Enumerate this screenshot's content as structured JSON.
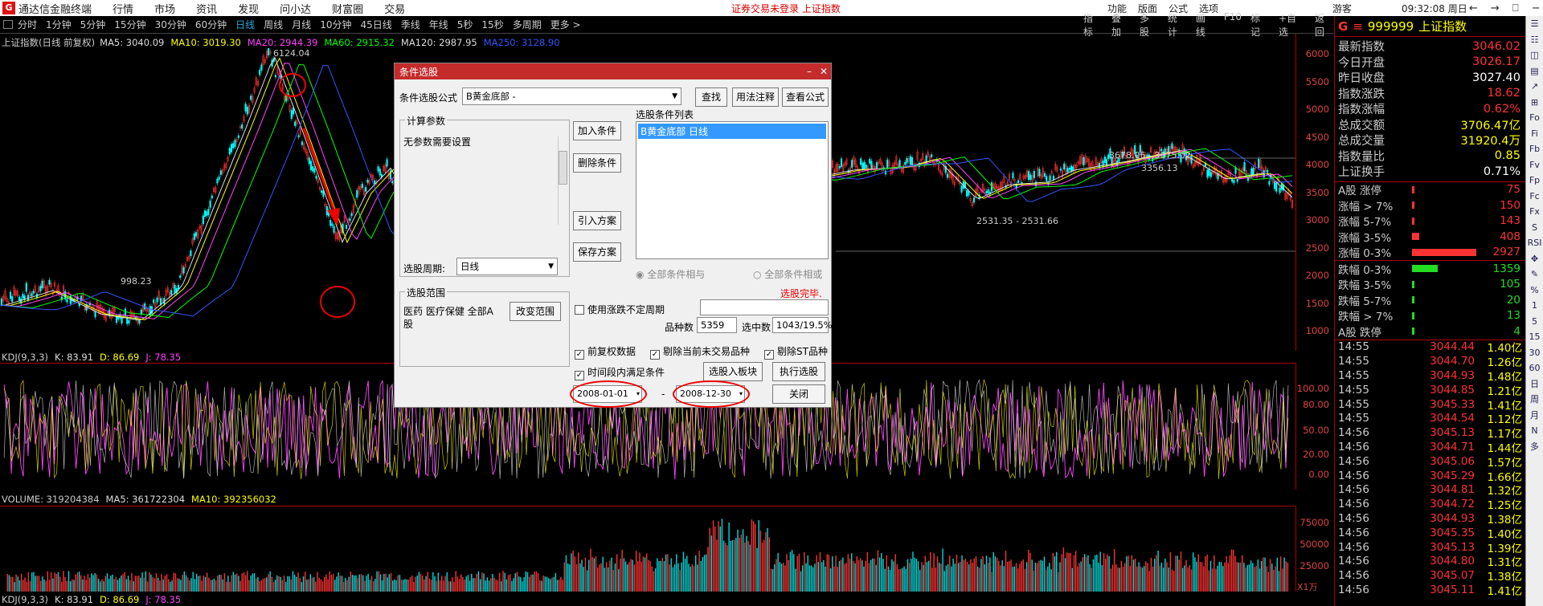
{
  "topbar": {
    "logo_text": "G",
    "app_title": "通达信金融终端",
    "menu": [
      "行情",
      "市场",
      "资讯",
      "发现",
      "问小达",
      "财富圈",
      "交易"
    ],
    "warning": "证券交易未登录  上证指数",
    "right_menu": [
      "功能",
      "版面",
      "公式",
      "选项"
    ],
    "user": "游客",
    "clock": "09:32:08 周日",
    "window_buttons": [
      "←",
      "→",
      "⎕",
      "−",
      "❐",
      "✕"
    ]
  },
  "periods": [
    "分时",
    "1分钟",
    "5分钟",
    "15分钟",
    "30分钟",
    "60分钟",
    "日线",
    "周线",
    "月线",
    "10分钟",
    "45日线",
    "季线",
    "年线",
    "5秒",
    "15秒",
    "多周期",
    "更多 >"
  ],
  "selected_period": "日线",
  "chart_tools": [
    "指标",
    "叠加",
    "多股",
    "统计",
    "画线",
    "F10",
    "标记",
    "+自选",
    "返回"
  ],
  "main_chart": {
    "title": "上证指数(日线 前复权)",
    "ma_legend": [
      {
        "label": "MA5: 3040.09",
        "color": "#dddddd"
      },
      {
        "label": "MA10: 3019.30",
        "color": "#ffff00"
      },
      {
        "label": "MA20: 2944.39",
        "color": "#ff40ff"
      },
      {
        "label": "MA60: 2915.32",
        "color": "#00ff00"
      },
      {
        "label": "MA120: 2987.95",
        "color": "#dddddd"
      },
      {
        "label": "MA250: 3128.90",
        "color": "#3355ff"
      }
    ],
    "y_ticks": [
      "6000",
      "5500",
      "5000",
      "4500",
      "4000",
      "3500",
      "3000",
      "2500",
      "2000",
      "1500",
      "1000"
    ],
    "annotations": [
      "6124.04",
      "998.23",
      "3678.06 - 3675.02",
      "2531.35 - 2531.66",
      "3356.13"
    ]
  },
  "kdj": {
    "legend": [
      {
        "label": "KDJ(9,3,3)",
        "color": "#cccccc"
      },
      {
        "label": "K: 83.91",
        "color": "#dddddd"
      },
      {
        "label": "D: 86.69",
        "color": "#ffff00"
      },
      {
        "label": "J: 78.35",
        "color": "#ff40ff"
      }
    ],
    "y_ticks": [
      "100.00",
      "80.00",
      "50.00",
      "20.00",
      "0.00"
    ]
  },
  "volume": {
    "legend": [
      {
        "label": "VOLUME: 319204384",
        "color": "#cccccc"
      },
      {
        "label": "MA5: 361722304",
        "color": "#dddddd"
      },
      {
        "label": "MA10: 392356032",
        "color": "#ffff00"
      }
    ],
    "y_ticks": [
      "75000",
      "50000",
      "25000"
    ],
    "unit": "X1万"
  },
  "bottom_legend": [
    {
      "label": "KDJ(9,3,3)",
      "color": "#cccccc"
    },
    {
      "label": "K: 83.91",
      "color": "#dddddd"
    },
    {
      "label": "D: 86.69",
      "color": "#ffff00"
    },
    {
      "label": "J: 78.35",
      "color": "#ff40ff"
    }
  ],
  "dialog": {
    "title": "条件选股",
    "formula_label": "条件选股公式",
    "formula_value": "B黄金底部  -",
    "find_btn": "查找",
    "usage_btn": "用法注释",
    "view_btn": "查看公式",
    "params_caption": "计算参数",
    "params_text": "无参数需要设置",
    "add_btn": "加入条件",
    "del_btn": "删除条件",
    "import_btn": "引入方案",
    "save_btn": "保存方案",
    "list_caption": "选股条件列表",
    "list_items": [
      "B黄金底部  日线"
    ],
    "period_label": "选股周期:",
    "period_value": "日线",
    "radio_and": "全部条件相与",
    "radio_or": "全部条件相或",
    "done_text": "选股完毕.",
    "range_caption": "选股范围",
    "range_text": "医药 医疗保健 全部A股",
    "change_range_btn": "改变范围",
    "irregular_label": "使用涨跌不定周期",
    "count_label": "品种数",
    "count_value": "5359",
    "selected_label": "选中数",
    "selected_value": "1043/19.5%",
    "opt_fq": "前复权数据",
    "opt_notrade": "剔除当前未交易品种",
    "opt_st": "剔除ST品种",
    "opt_period": "时间段内满足条件",
    "to_block_btn": "选股入板块",
    "run_btn": "执行选股",
    "date_from": "2008-01-01",
    "date_sep": "-",
    "date_to": "2008-12-30",
    "close_btn": "关闭"
  },
  "quote_panel": {
    "code": "999999",
    "name": "上证指数",
    "stats": [
      {
        "label": "最新指数",
        "value": "3046.02",
        "color": "#ff3333"
      },
      {
        "label": "今日开盘",
        "value": "3026.17",
        "color": "#ff3333"
      },
      {
        "label": "昨日收盘",
        "value": "3027.40",
        "color": "#ffffff"
      },
      {
        "label": "指数涨跌",
        "value": "18.62",
        "color": "#ff3333"
      },
      {
        "label": "指数涨幅",
        "value": "0.62%",
        "color": "#ff3333"
      },
      {
        "label": "总成交额",
        "value": "3706.47亿",
        "color": "#ffff00"
      },
      {
        "label": "总成交量",
        "value": "31920.4万",
        "color": "#ffff00"
      },
      {
        "label": "指数量比",
        "value": "0.85",
        "color": "#ffff00"
      },
      {
        "label": "上证换手",
        "value": "0.71%",
        "color": "#ffffff"
      }
    ],
    "breadth_up": [
      {
        "label": "A股 涨停",
        "value": "75",
        "bar": 0.02
      },
      {
        "label": "涨幅 > 7%",
        "value": "150",
        "bar": 0.03
      },
      {
        "label": "涨幅 5-7%",
        "value": "143",
        "bar": 0.03
      },
      {
        "label": "涨幅 3-5%",
        "value": "408",
        "bar": 0.11
      },
      {
        "label": "涨幅 0-3%",
        "value": "2927",
        "bar": 0.97
      }
    ],
    "breadth_down": [
      {
        "label": "跌幅 0-3%",
        "value": "1359",
        "bar": 0.39
      },
      {
        "label": "跌幅 3-5%",
        "value": "105",
        "bar": 0.02
      },
      {
        "label": "跌幅 5-7%",
        "value": "20",
        "bar": 0.01
      },
      {
        "label": "跌幅 > 7%",
        "value": "13",
        "bar": 0.01
      },
      {
        "label": "A股 跌停",
        "value": "4",
        "bar": 0.01
      }
    ],
    "ticks": [
      {
        "t": "14:55",
        "p": "3044.44",
        "v": "1.40亿"
      },
      {
        "t": "14:55",
        "p": "3044.70",
        "v": "1.26亿"
      },
      {
        "t": "14:55",
        "p": "3044.93",
        "v": "1.48亿"
      },
      {
        "t": "14:55",
        "p": "3044.85",
        "v": "1.21亿"
      },
      {
        "t": "14:55",
        "p": "3045.33",
        "v": "1.41亿"
      },
      {
        "t": "14:55",
        "p": "3044.54",
        "v": "1.12亿"
      },
      {
        "t": "14:56",
        "p": "3045.13",
        "v": "1.17亿"
      },
      {
        "t": "14:56",
        "p": "3044.71",
        "v": "1.44亿"
      },
      {
        "t": "14:56",
        "p": "3045.06",
        "v": "1.57亿"
      },
      {
        "t": "14:56",
        "p": "3045.29",
        "v": "1.66亿"
      },
      {
        "t": "14:56",
        "p": "3044.81",
        "v": "1.32亿"
      },
      {
        "t": "14:56",
        "p": "3044.72",
        "v": "1.25亿"
      },
      {
        "t": "14:56",
        "p": "3044.93",
        "v": "1.38亿"
      },
      {
        "t": "14:56",
        "p": "3045.35",
        "v": "1.40亿"
      },
      {
        "t": "14:56",
        "p": "3045.13",
        "v": "1.39亿"
      },
      {
        "t": "14:56",
        "p": "3044.80",
        "v": "1.31亿"
      },
      {
        "t": "14:56",
        "p": "3045.07",
        "v": "1.38亿"
      },
      {
        "t": "14:56",
        "p": "3045.11",
        "v": "1.41亿"
      }
    ]
  },
  "side_tools": [
    "☰",
    "☷",
    "◫",
    "▤",
    "↗",
    "⊞",
    "Fo",
    "Fi",
    "Fb",
    "Fv",
    "Fp",
    "Fc",
    "Fx",
    "S",
    "RSI",
    "✥",
    "✎",
    "%",
    "1",
    "5",
    "15",
    "30",
    "60",
    "日",
    "周",
    "月",
    "N",
    "多"
  ]
}
